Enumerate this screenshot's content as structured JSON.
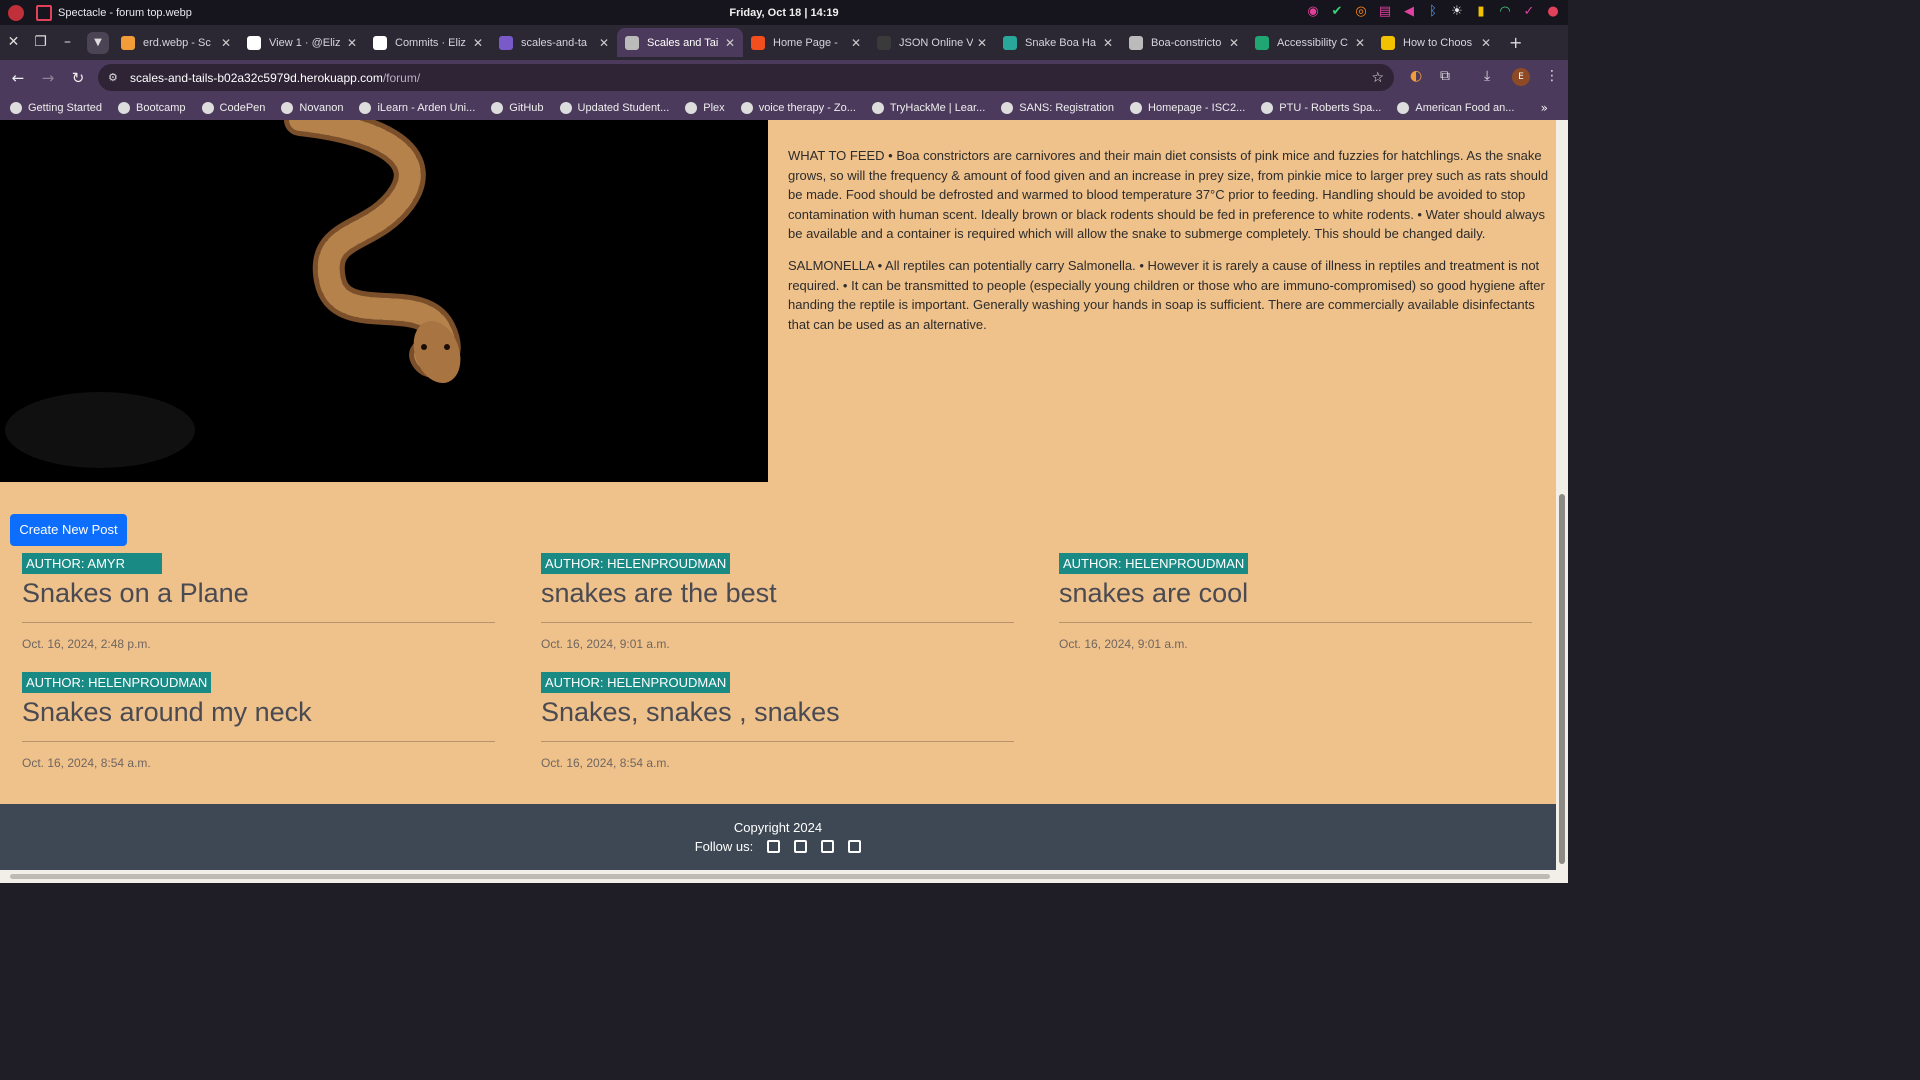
{
  "system": {
    "window_title": "Spectacle - forum top.webp",
    "clock": "Friday, Oct 18 | 14:19"
  },
  "tabs": [
    {
      "label": "erd.webp - Sc",
      "icon": "coda-icon",
      "color": "#f29d38"
    },
    {
      "label": "View 1 · @Eliz",
      "icon": "github-icon",
      "color": "#ffffff"
    },
    {
      "label": "Commits · Eliz",
      "icon": "github-icon",
      "color": "#ffffff"
    },
    {
      "label": "scales-and-ta",
      "icon": "heroku-icon",
      "color": "#7a5ac8"
    },
    {
      "label": "Scales and Tai",
      "icon": "globe-icon",
      "color": "#bbbbbb",
      "active": true
    },
    {
      "label": "Home Page - ",
      "icon": "figma-icon",
      "color": "#f24e1e"
    },
    {
      "label": "JSON Online V",
      "icon": "json-icon",
      "color": "#3a3a3a"
    },
    {
      "label": "Snake Boa Ha",
      "icon": "d-icon",
      "color": "#2aa79b"
    },
    {
      "label": "Boa-constricto",
      "icon": "globe-icon",
      "color": "#bbbbbb"
    },
    {
      "label": "Accessibility C",
      "icon": "accessibility-icon",
      "color": "#1fa672"
    },
    {
      "label": "How to Choos",
      "icon": "sun-icon",
      "color": "#f2c200"
    }
  ],
  "address": {
    "host": "scales-and-tails-b02a32c5979d.herokuapp.com",
    "path": "/forum/"
  },
  "bookmarks": [
    "Getting Started",
    "Bootcamp",
    "CodePen",
    "Novanon",
    "iLearn - Arden Uni...",
    "GitHub",
    "Updated Student...",
    "Plex",
    "voice therapy - Zo...",
    "TryHackMe | Lear...",
    "SANS: Registration",
    "Homepage - ISC2...",
    "PTU - Roberts Spa...",
    "American Food an..."
  ],
  "profile_initial": "E",
  "care": {
    "feed": "WHAT TO FEED • Boa constrictors are carnivores and their main diet consists of pink mice and fuzzies for hatchlings. As the snake grows, so will the frequency & amount of food given and an increase in prey size, from pinkie mice to larger prey such as rats should be made. Food should be defrosted and warmed to blood temperature 37°C prior to feeding. Handling should be avoided to stop contamination with human scent. Ideally brown or black rodents should be fed in preference to white rodents. • Water should always be available and a container is required which will allow the snake to submerge completely. This should be changed daily.",
    "salmonella": "SALMONELLA • All reptiles can potentially carry Salmonella. • However it is rarely a cause of illness in reptiles and treatment is not required. • It can be transmitted to people (especially young children or those who are immuno-compromised) so good hygiene after handing the reptile is important. Generally washing your hands in soap is sufficient. There are commercially available disinfectants that can be used as an alternative."
  },
  "forum": {
    "create_label": "Create New Post",
    "posts": [
      {
        "author": "AUTHOR: AMYR",
        "title": "Snakes on a Plane",
        "date": "Oct. 16, 2024, 2:48 p.m."
      },
      {
        "author": "AUTHOR: HELENPROUDMAN",
        "title": "snakes are the best",
        "date": "Oct. 16, 2024, 9:01 a.m."
      },
      {
        "author": "AUTHOR: HELENPROUDMAN",
        "title": "snakes are cool",
        "date": "Oct. 16, 2024, 9:01 a.m."
      },
      {
        "author": "AUTHOR: HELENPROUDMAN",
        "title": "Snakes around my neck",
        "date": "Oct. 16, 2024, 8:54 a.m."
      },
      {
        "author": "AUTHOR: HELENPROUDMAN",
        "title": "Snakes, snakes , snakes",
        "date": "Oct. 16, 2024, 8:54 a.m."
      }
    ]
  },
  "footer": {
    "copyright": "Copyright 2024",
    "follow": "Follow us:",
    "social": [
      "facebook-icon",
      "twitter-icon",
      "instagram-icon",
      "youtube-icon"
    ]
  }
}
